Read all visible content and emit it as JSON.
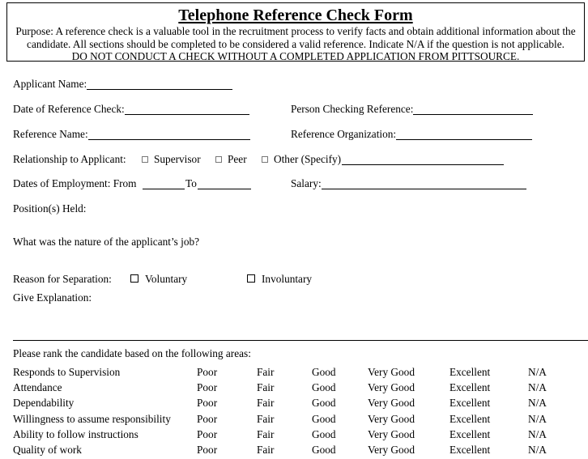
{
  "header": {
    "title": "Telephone Reference Check Form",
    "purpose_line1": "Purpose:  A reference check is a valuable tool in the recruitment process to verify facts and obtain additional information about the",
    "purpose_line2": "candidate.  All sections should be completed to be considered a valid reference.  Indicate N/A if the question is not applicable.",
    "purpose_line3": "DO NOT CONDUCT A CHECK WITHOUT A COMPLETED APPLICATION FROM PITTSOURCE."
  },
  "fields": {
    "applicant_name": "Applicant Name:",
    "date_of_check": "Date of Reference Check:",
    "person_checking": "Person Checking Reference:",
    "reference_name": "Reference Name:",
    "reference_org": "Reference Organization:",
    "relationship": "Relationship to Applicant:",
    "relationship_options": [
      "Supervisor",
      "Peer",
      "Other (Specify)"
    ],
    "dates_of_employment": "Dates of Employment:  From",
    "to": "To",
    "salary": "Salary:",
    "positions_held": "Position(s) Held:",
    "job_nature": "What was the nature of the applicant’s job?",
    "reason_for_separation": "Reason for Separation:",
    "separation_options": [
      "Voluntary",
      "Involuntary"
    ],
    "give_explanation": "Give Explanation:"
  },
  "ranking": {
    "intro": "Please rank the candidate based on the following areas:",
    "scale": [
      "Poor",
      "Fair",
      "Good",
      "Very Good",
      "Excellent",
      "N/A"
    ],
    "areas": [
      "Responds to Supervision",
      "Attendance",
      "Dependability",
      "Willingness to assume responsibility",
      "Ability to follow instructions",
      "Quality of work"
    ]
  }
}
